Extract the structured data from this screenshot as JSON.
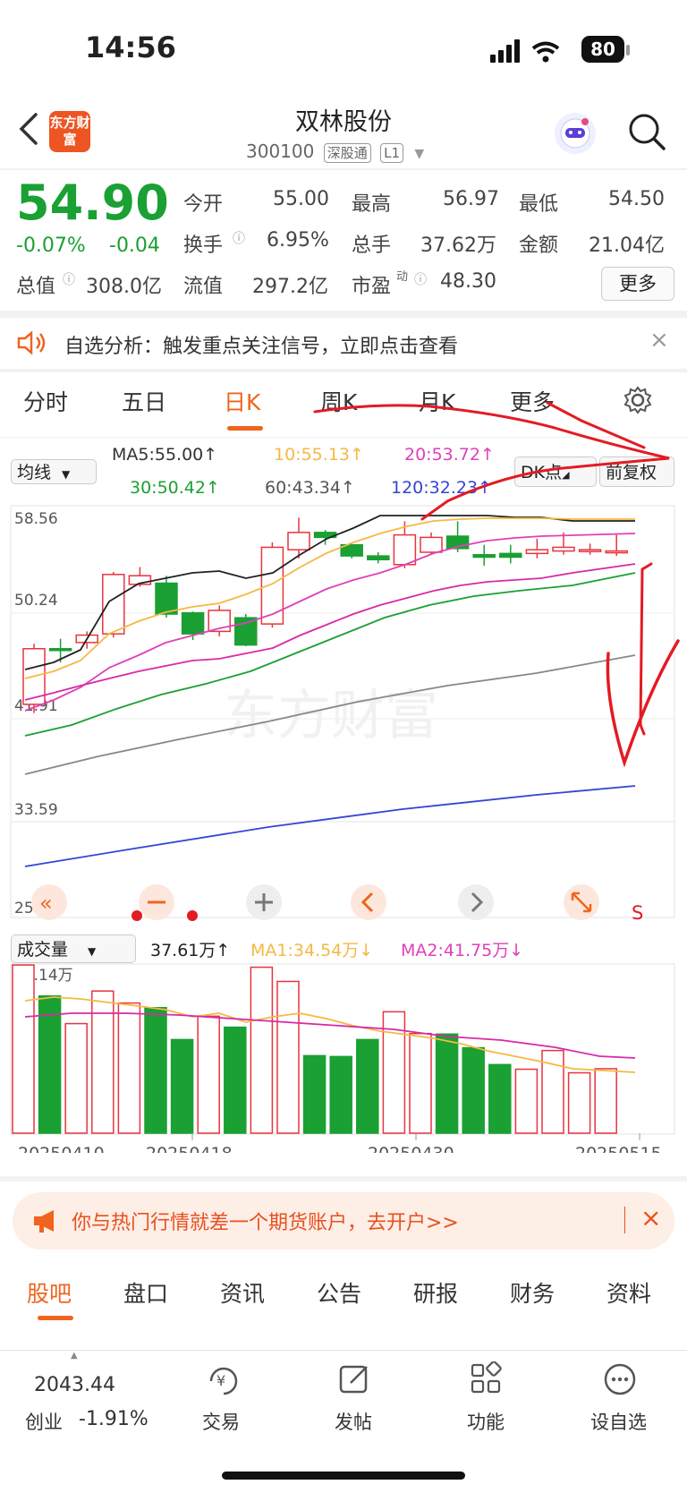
{
  "status_bar": {
    "time": "14:56",
    "battery": "80"
  },
  "header": {
    "logo_text": "东方财富",
    "title": "双林股份",
    "code": "300100",
    "market": "深股通",
    "level": "L1"
  },
  "quote": {
    "price": "54.90",
    "change_pct": "-0.07%",
    "change": "-0.04",
    "open_label": "今开",
    "open": "55.00",
    "high_label": "最高",
    "high": "56.97",
    "low_label": "最低",
    "low": "54.50",
    "turnover_label": "换手",
    "turnover": "6.95%",
    "volume_label": "总手",
    "volume": "37.62万",
    "amount_label": "金额",
    "amount": "21.04亿",
    "mktcap_label": "总值",
    "mktcap": "308.0亿",
    "float_label": "流值",
    "float_cap": "297.2亿",
    "pe_label": "市盈",
    "pe_sup": "动",
    "pe": "48.30",
    "more_label": "更多"
  },
  "notice": {
    "text": "自选分析：触发重点关注信号，立即点击查看"
  },
  "tabs": [
    "分时",
    "五日",
    "日K",
    "周K",
    "月K",
    "更多"
  ],
  "active_tab": "日K",
  "kline": {
    "indicator": "均线",
    "ma5": "MA5:55.00↑",
    "ma10": "10:55.13↑",
    "ma20": "20:53.72↑",
    "ma30": "30:50.42↑",
    "ma60": "60:43.34↑",
    "ma120": "120:32.23↑",
    "dk_label": "DK点",
    "fq_label": "前复权",
    "price_ticks": [
      "58.56",
      "50.24",
      "41.91",
      "33.59",
      "25.27"
    ],
    "watermark": "东方财富",
    "s_label": "S"
  },
  "volume": {
    "indicator": "成交量",
    "value": "37.61万↑",
    "ma1": "MA1:34.54万↓",
    "ma2": "MA2:41.75万↓",
    "max_tick": "98.14万",
    "dates": [
      "20250410",
      "20250418",
      "20250430",
      "20250515"
    ]
  },
  "chart_data": {
    "type": "candlestick",
    "ylim": [
      25.27,
      58.56
    ],
    "candles": [
      {
        "o": 42.5,
        "c": 47.0,
        "h": 47.4,
        "l": 41.8
      },
      {
        "o": 47.0,
        "c": 46.9,
        "h": 47.8,
        "l": 45.9
      },
      {
        "o": 47.5,
        "c": 48.1,
        "h": 48.4,
        "l": 47.0
      },
      {
        "o": 48.2,
        "c": 53.0,
        "h": 53.2,
        "l": 47.9
      },
      {
        "o": 52.2,
        "c": 52.9,
        "h": 53.6,
        "l": 52.0
      },
      {
        "o": 52.3,
        "c": 49.8,
        "h": 52.9,
        "l": 49.5
      },
      {
        "o": 49.9,
        "c": 48.2,
        "h": 50.0,
        "l": 47.7
      },
      {
        "o": 48.4,
        "c": 50.1,
        "h": 50.5,
        "l": 48.0
      },
      {
        "o": 49.5,
        "c": 47.3,
        "h": 49.8,
        "l": 47.2
      },
      {
        "o": 49.0,
        "c": 55.2,
        "h": 55.6,
        "l": 48.7
      },
      {
        "o": 55.0,
        "c": 56.4,
        "h": 57.6,
        "l": 54.3
      },
      {
        "o": 56.4,
        "c": 56.0,
        "h": 56.6,
        "l": 55.4
      },
      {
        "o": 55.4,
        "c": 54.5,
        "h": 55.5,
        "l": 54.3
      },
      {
        "o": 54.5,
        "c": 54.2,
        "h": 54.8,
        "l": 53.9
      },
      {
        "o": 53.8,
        "c": 56.2,
        "h": 57.3,
        "l": 53.5
      },
      {
        "o": 54.8,
        "c": 56.0,
        "h": 56.4,
        "l": 54.6
      },
      {
        "o": 56.1,
        "c": 55.1,
        "h": 57.3,
        "l": 54.8
      },
      {
        "o": 54.6,
        "c": 54.4,
        "h": 55.4,
        "l": 53.7
      },
      {
        "o": 54.7,
        "c": 54.4,
        "h": 55.4,
        "l": 53.9
      },
      {
        "o": 54.7,
        "c": 55.0,
        "h": 55.9,
        "l": 54.3
      },
      {
        "o": 54.9,
        "c": 55.2,
        "h": 56.4,
        "l": 54.6
      },
      {
        "o": 55.0,
        "c": 55.0,
        "h": 55.5,
        "l": 54.6
      },
      {
        "o": 54.9,
        "c": 54.9,
        "h": 56.2,
        "l": 54.5
      }
    ],
    "volumes": [
      98.1,
      80.0,
      63.9,
      82.9,
      75.9,
      73.2,
      54.6,
      68.2,
      61.8,
      96.8,
      88.5,
      45.2,
      44.7,
      54.6,
      70.8,
      58.1,
      57.8,
      49.8,
      40.0,
      37.3,
      48.2,
      35.2,
      37.6
    ],
    "volume_ylim": [
      0,
      98.14
    ]
  },
  "ad": {
    "text": "你与热门行情就差一个期货账户，去开户>>"
  },
  "bottom_tabs": [
    "股吧",
    "盘口",
    "资讯",
    "公告",
    "研报",
    "财务",
    "资料"
  ],
  "active_bottom_tab": "股吧",
  "bottom_nav": {
    "index_value": "2043.44",
    "index_name": "创业",
    "index_change": "-1.91%",
    "items": [
      "交易",
      "发帖",
      "功能",
      "设自选"
    ]
  },
  "colors": {
    "up": "#e8343f",
    "down": "#1aa033",
    "accent": "#f0641e",
    "annotation": "#e31b23"
  }
}
